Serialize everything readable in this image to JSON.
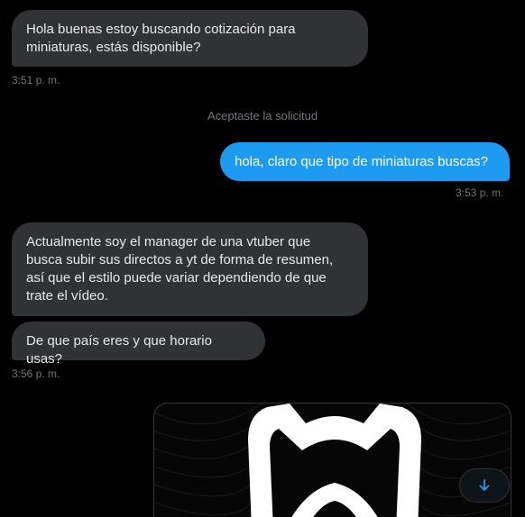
{
  "messages": [
    {
      "text": "Hola buenas estoy buscando cotización para\nminiaturas, estás disponible?",
      "direction": "incoming"
    },
    {
      "text": "hola, claro que tipo de miniaturas buscas?",
      "direction": "outgoing"
    },
    {
      "text": "Actualmente soy el manager de una vtuber que\nbusca subir sus directos a yt de forma de resumen,\nasí que el estilo puede variar dependiendo de que\ntrate el vídeo.",
      "direction": "incoming"
    },
    {
      "text": "De que país eres y que horario usas?",
      "direction": "incoming"
    }
  ],
  "timestamps": [
    "3:51 p. m.",
    "3:53 p. m.",
    "3:56 p. m."
  ],
  "system_notice": "Aceptaste la solicitud",
  "attachment": {
    "icon": "fox-logo-image"
  },
  "scroll_button": {
    "icon": "arrow-down-icon"
  },
  "colors": {
    "background": "#000000",
    "incoming_bubble": "#2f3336",
    "outgoing_bubble": "#1d9bf0",
    "timestamp": "#71767b",
    "accent": "#1d9bf0"
  }
}
